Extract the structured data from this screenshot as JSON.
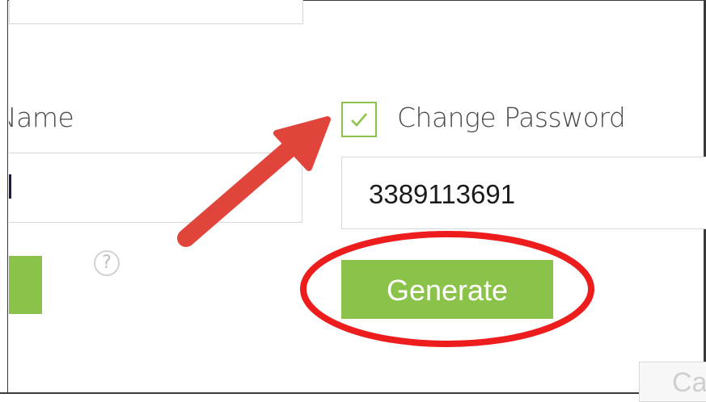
{
  "form": {
    "name_label": "Name",
    "change_password_label": "Change Password",
    "change_password_checked": true,
    "password_value": "3389113691",
    "generate_label": "Generate",
    "cancel_label": "Ca",
    "help_icon_glyph": "?"
  },
  "colors": {
    "accent_green": "#8bc34a",
    "annotation_red": "#e0443a",
    "ellipse_red": "#ee1d1d"
  },
  "icons": {
    "checkbox": "check-icon",
    "help": "question-circle-icon",
    "annotation": "arrow-annotation-icon"
  }
}
